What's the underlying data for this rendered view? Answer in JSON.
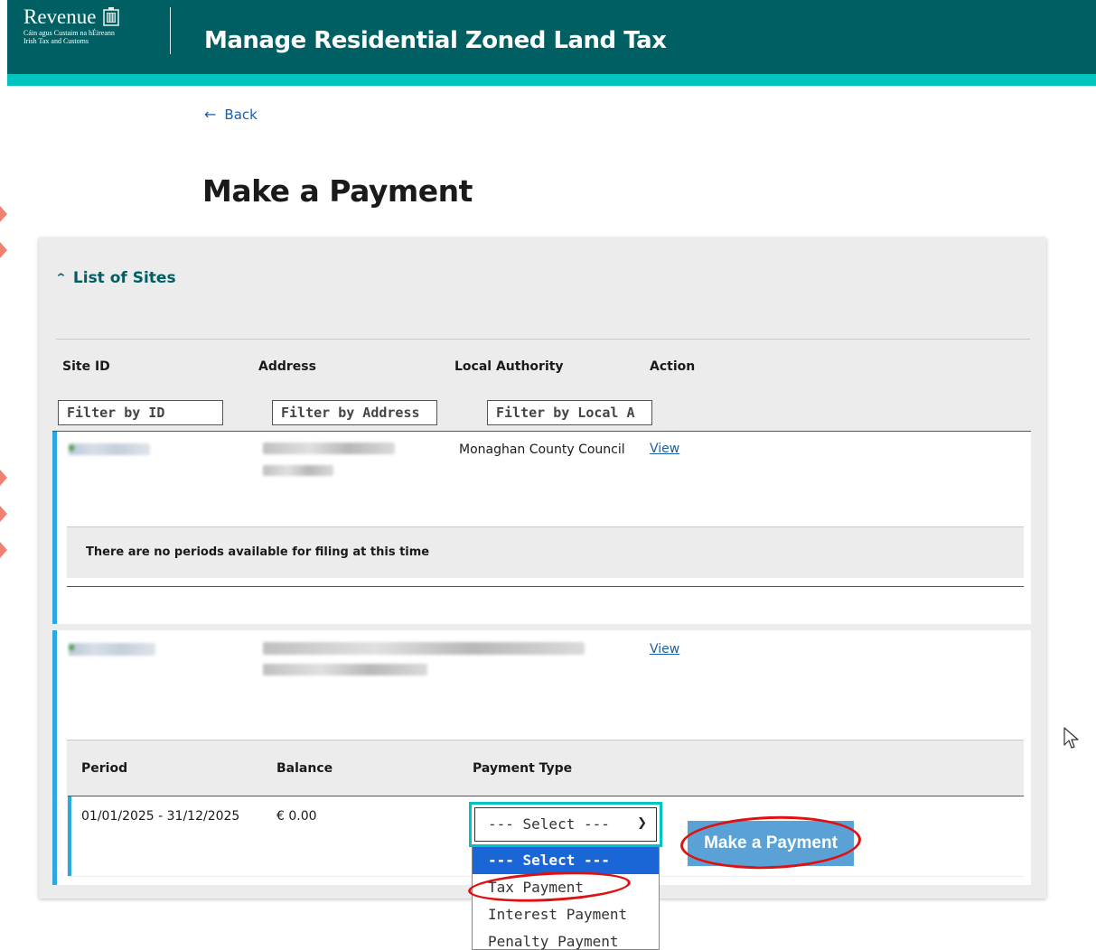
{
  "header": {
    "logo_word": "Revenue",
    "logo_line1": "Cáin agus Custaim na hÉireann",
    "logo_line2": "Irish Tax and Customs",
    "app_title": "Manage Residential Zoned Land Tax"
  },
  "nav": {
    "back_label": "Back"
  },
  "page_title": "Make a Payment",
  "sites": {
    "toggle_label": "List of Sites",
    "columns": [
      "Site ID",
      "Address",
      "Local Authority",
      "Action"
    ],
    "filters": {
      "id_placeholder": "Filter by ID",
      "address_placeholder": "Filter by Address",
      "authority_placeholder": "Filter by Local A"
    },
    "rows": [
      {
        "local_authority": "Monaghan County Council",
        "action": "View",
        "notice": "There are no periods available for filing at this time"
      },
      {
        "local_authority": "",
        "action": "View"
      }
    ]
  },
  "periods": {
    "columns": [
      "Period",
      "Balance",
      "Payment Type"
    ],
    "rows": [
      {
        "period": "01/01/2025 - 31/12/2025",
        "balance": "€ 0.00"
      }
    ],
    "payment_type": {
      "selected": "--- Select ---",
      "options": [
        "--- Select ---",
        "Tax Payment",
        "Interest Payment",
        "Penalty Payment"
      ]
    },
    "submit_label": "Make a Payment"
  },
  "colors": {
    "header_bg": "#005f62",
    "header_stripe": "#00c4c0",
    "accent_blue": "#2ba8e0",
    "link": "#1a5fa8",
    "button": "#5aa2d6",
    "highlight_ring": "#e01010",
    "dropdown_selected": "#1b66d6"
  },
  "icons": [
    "harp-crest-icon",
    "back-arrow-icon",
    "caret-up-icon",
    "chevron-down-icon",
    "mouse-pointer-icon"
  ]
}
